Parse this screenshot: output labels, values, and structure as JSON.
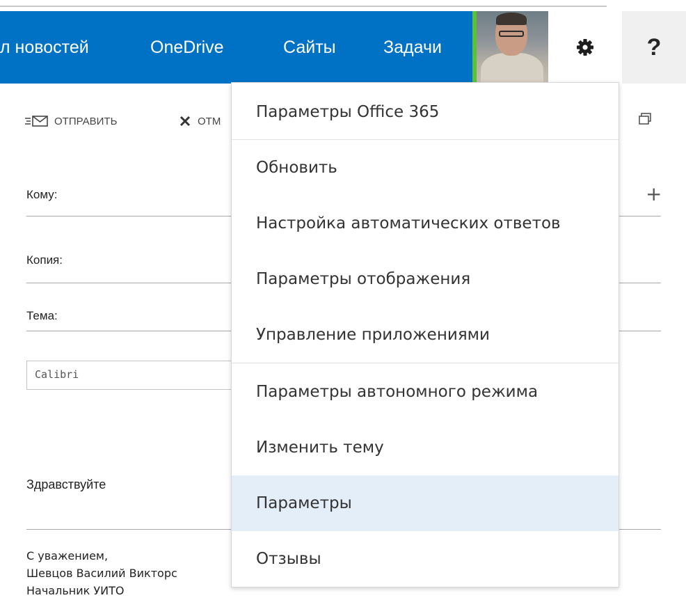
{
  "nav": {
    "items": [
      {
        "label": "л новостей"
      },
      {
        "label": "OneDrive"
      },
      {
        "label": "Сайты"
      },
      {
        "label": "Задачи"
      }
    ],
    "help_label": "?",
    "accent_color": "#0072c6",
    "presence_color": "#5bc236"
  },
  "toolbar": {
    "send_label": "ОТПРАВИТЬ",
    "cancel_label": "ОТМ"
  },
  "compose": {
    "to_label": "Кому:",
    "cc_label": "Копия:",
    "subject_label": "Тема:",
    "add_label": "+",
    "font_value": "Calibri",
    "greeting": "Здравствуйте",
    "signature": [
      "С уважением,",
      "Шевцов Василий Викторс",
      "Начальник УИТО"
    ]
  },
  "settings_menu": {
    "items": [
      {
        "label": "Параметры Office 365"
      },
      {
        "label": "Обновить"
      },
      {
        "label": "Настройка автоматических ответов"
      },
      {
        "label": "Параметры отображения"
      },
      {
        "label": "Управление приложениями"
      },
      {
        "label": "Параметры автономного режима"
      },
      {
        "label": "Изменить тему"
      },
      {
        "label": "Параметры"
      },
      {
        "label": "Отзывы"
      }
    ],
    "highlighted": "Параметры",
    "highlight_color": "#e3eef8"
  }
}
